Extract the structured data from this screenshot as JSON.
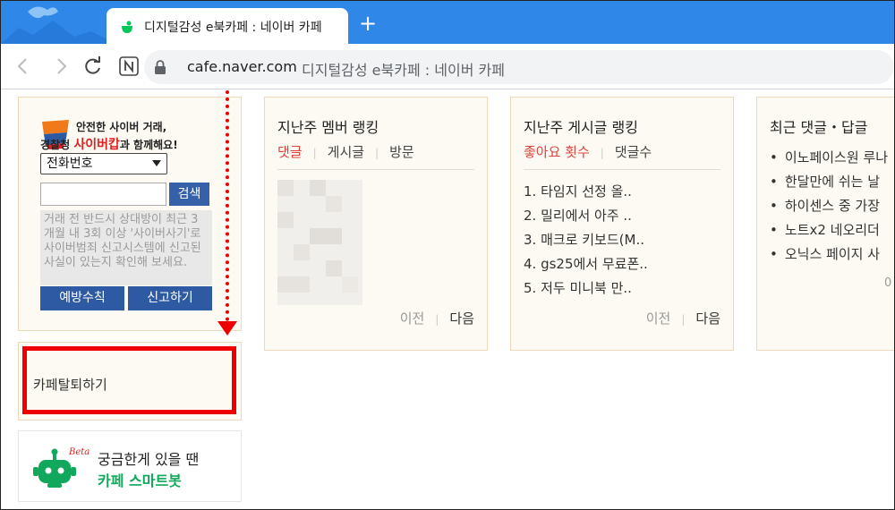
{
  "browser": {
    "tab_title": "디지털감성 e북카페 : 네이버 카페",
    "new_tab_label": "+",
    "url_domain": "cafe.naver.com",
    "url_page_title": "디지털감성 e북카페 : 네이버 카페"
  },
  "cyber": {
    "line1": "안전한 사이버 거래,",
    "line2_prefix": "경찰청 ",
    "line2_brand": "사이버캅",
    "line2_suffix": "과 함께해요!",
    "select_value": "전화번호",
    "search_label": "검색",
    "notice": "거래 전 반드시 상대방이 최근 3개월 내 3회 이상 '사이버사기'로 사이버범죄 신고시스템에 신고된 사실이 있는지 확인해 보세요.",
    "prevention_label": "예방수칙",
    "report_label": "신고하기"
  },
  "leave": {
    "label": "카페탈퇴하기"
  },
  "smartbot": {
    "beta": "Beta",
    "line1": "궁금한게 있을 땐",
    "line2": "카페 스마트봇"
  },
  "member_rank": {
    "title": "지난주 멤버 랭킹",
    "tabs": [
      "댓글",
      "게시글",
      "방문"
    ],
    "prev": "이전",
    "next": "다음"
  },
  "post_rank": {
    "title": "지난주 게시글 랭킹",
    "tabs": [
      "좋아요 횟수",
      "댓글수"
    ],
    "items": [
      "1. 타임지 선정 올..",
      "2. 밀리에서 아주 ..",
      "3. 매크로 키보드(M..",
      "4. gs25에서 무료폰..",
      "5. 저두 미니북 만.."
    ],
    "prev": "이전",
    "next": "다음"
  },
  "recent_comments": {
    "title": "최근 댓글・답글",
    "items": [
      "이노페이스원 루나",
      "한달만에 쉬는 날",
      "하이센스 중 가장",
      "노트x2 네오리더",
      "오닉스 페이지 사"
    ],
    "page_indicator": "0"
  },
  "colors": {
    "tabstrip": "#2f87e8",
    "accent_red": "#e0433a",
    "button_blue": "#2d5aa3",
    "naver_green": "#10a85a",
    "box_bg": "#fdfaf3",
    "box_border": "#f0d9b8"
  }
}
